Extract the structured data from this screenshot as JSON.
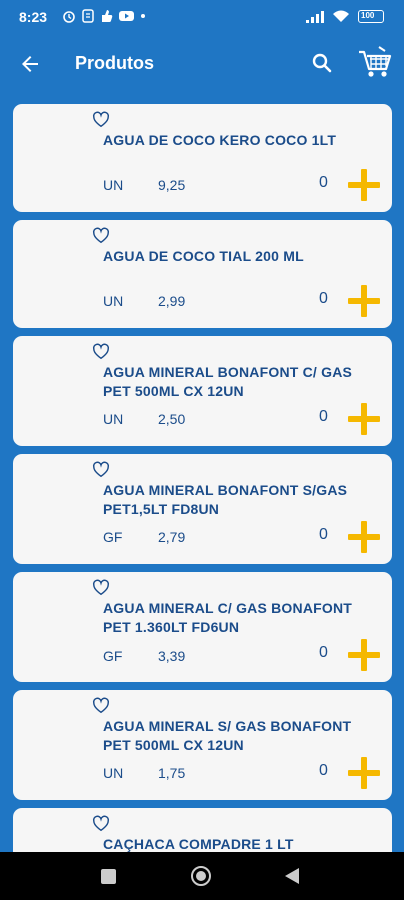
{
  "status_bar": {
    "time": "8:23",
    "battery": "100"
  },
  "app_bar": {
    "title": "Produtos"
  },
  "products": [
    {
      "name": "AGUA DE COCO KERO COCO 1LT",
      "unit": "UN",
      "price": "9,25",
      "qty": "0"
    },
    {
      "name": "AGUA DE COCO TIAL 200 ML",
      "unit": "UN",
      "price": "2,99",
      "qty": "0"
    },
    {
      "name": "AGUA MINERAL BONAFONT C/ GAS PET 500ML CX 12UN",
      "unit": "UN",
      "price": "2,50",
      "qty": "0"
    },
    {
      "name": "AGUA MINERAL BONAFONT S/GAS PET1,5LT FD8UN",
      "unit": "GF",
      "price": "2,79",
      "qty": "0"
    },
    {
      "name": "AGUA MINERAL C/ GAS BONAFONT PET 1.360LT FD6UN",
      "unit": "GF",
      "price": "3,39",
      "qty": "0"
    },
    {
      "name": "AGUA MINERAL S/ GAS BONAFONT PET 500ML CX 12UN",
      "unit": "UN",
      "price": "1,75",
      "qty": "0"
    },
    {
      "name": "CAÇHACA COMPADRE 1 LT",
      "unit": "",
      "price": "",
      "qty": ""
    }
  ],
  "colors": {
    "primary": "#1f76c4",
    "card": "#f6f6f6",
    "text": "#1b4c8a",
    "accent": "#f5b800"
  },
  "icons": {
    "back": "arrow-left-icon",
    "search": "search-icon",
    "cart": "cart-icon",
    "favorite": "heart-outline-icon",
    "add": "plus-icon"
  }
}
